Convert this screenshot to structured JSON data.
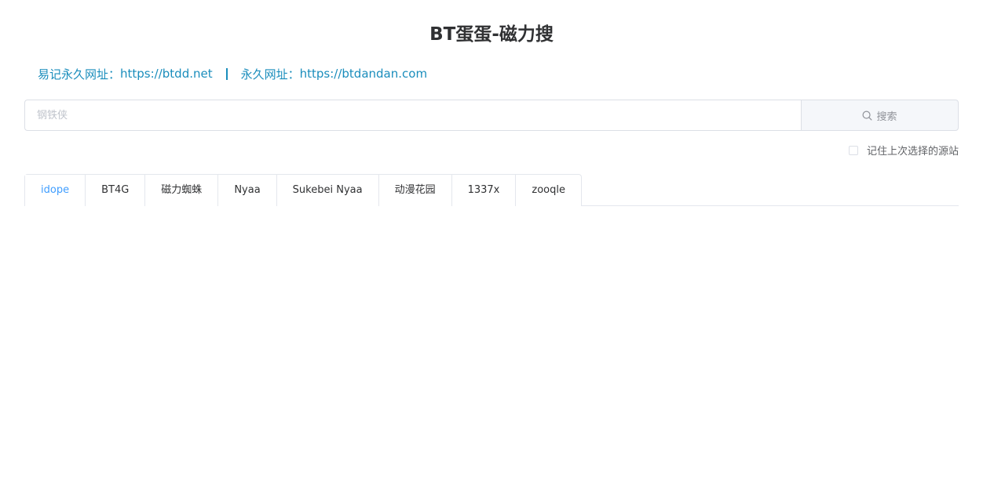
{
  "header": {
    "title": "BT蛋蛋-磁力搜"
  },
  "urls": {
    "easy_label": "易记永久网址：",
    "easy_url": "https://btdd.net",
    "perm_label": "永久网址：",
    "perm_url": "https://btdandan.com"
  },
  "search": {
    "placeholder": "钢铁侠",
    "value": "",
    "button_label": "搜索",
    "icon": "search-icon"
  },
  "remember": {
    "label": "记住上次选择的源站",
    "checked": false
  },
  "tabs": [
    {
      "label": "idope",
      "active": true
    },
    {
      "label": "BT4G",
      "active": false
    },
    {
      "label": "磁力蜘蛛",
      "active": false
    },
    {
      "label": "Nyaa",
      "active": false
    },
    {
      "label": "Sukebei Nyaa",
      "active": false
    },
    {
      "label": "动漫花园",
      "active": false
    },
    {
      "label": "1337x",
      "active": false
    },
    {
      "label": "zooqle",
      "active": false
    }
  ],
  "colors": {
    "link": "#1a8dbc",
    "active_tab": "#409eff",
    "border": "#dcdfe6"
  }
}
